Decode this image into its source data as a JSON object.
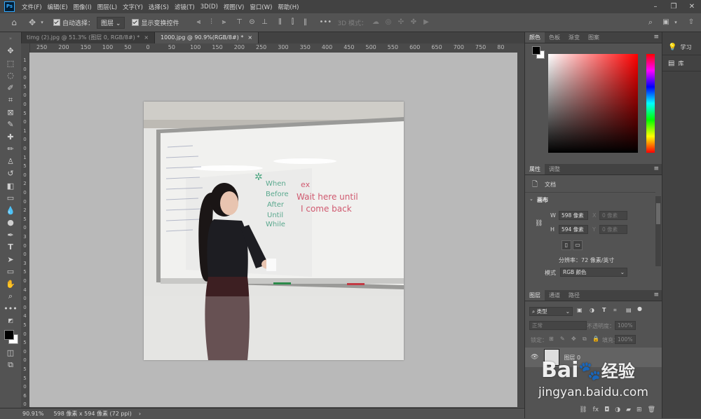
{
  "menu": {
    "items": [
      "文件(F)",
      "编辑(E)",
      "图像(I)",
      "图层(L)",
      "文字(Y)",
      "选择(S)",
      "滤镜(T)",
      "3D(D)",
      "视图(V)",
      "窗口(W)",
      "帮助(H)"
    ]
  },
  "options": {
    "auto_select_label": "自动选择：",
    "auto_select_value": "图层",
    "show_transform_label": "显示变换控件",
    "mode_3d_label": "3D 模式："
  },
  "tabs": [
    {
      "label": "timg (2).jpg @ 51.3% (图层 0, RGB/8#) *"
    },
    {
      "label": "1000.jpg @ 90.9%(RGB/8#) *"
    }
  ],
  "ruler": {
    "h_labels": [
      "250",
      "200",
      "150",
      "100",
      "50",
      "0",
      "50",
      "100",
      "150",
      "200",
      "250",
      "300",
      "350",
      "400",
      "450",
      "500",
      "550",
      "600",
      "650",
      "700",
      "750",
      "80"
    ],
    "v_labels": [
      "1",
      "0",
      "0",
      "5",
      "0",
      "0",
      "5",
      "0",
      "1",
      "0",
      "0",
      "1",
      "5",
      "0",
      "2",
      "0",
      "0",
      "2",
      "5",
      "0",
      "3",
      "0",
      "0",
      "3",
      "5",
      "0",
      "4",
      "0",
      "0",
      "4",
      "5",
      "0",
      "5",
      "0",
      "0",
      "5",
      "5",
      "0",
      "6",
      "0"
    ]
  },
  "whiteboard": {
    "green_words": [
      "When",
      "Before",
      "After",
      "Until",
      "While"
    ],
    "red_words": [
      "ex",
      "Wait here until",
      "I come back"
    ]
  },
  "status": {
    "zoom": "90.91%",
    "doc_info": "598 像素 x 594 像素 (72 ppi)"
  },
  "color_panel": {
    "tabs": [
      "颜色",
      "色板",
      "渐变",
      "图案"
    ]
  },
  "properties_panel": {
    "tabs": [
      "属性",
      "调整"
    ],
    "doc_label": "文档",
    "section": "画布",
    "w_label": "W",
    "w_value": "598 像素",
    "h_label": "H",
    "h_value": "594 像素",
    "x_label": "X",
    "x_value": "0 像素",
    "y_label": "Y",
    "y_value": "0 像素",
    "resolution": "分辨率：72 像素/英寸",
    "mode_label": "模式",
    "mode_value": "RGB 颜色"
  },
  "layers_panel": {
    "tabs": [
      "图层",
      "通道",
      "路径"
    ],
    "filter_value": "类型",
    "blend_mode": "正常",
    "opacity_label": "不透明度：",
    "opacity_value": "100%",
    "lock_label": "锁定：",
    "fill_label": "填充：",
    "fill_value": "100%",
    "layer_name": "图层 0"
  },
  "side": {
    "learn": "学习",
    "library": "库"
  },
  "watermark": {
    "brand_a": "Bai",
    "brand_b": "经验",
    "url": "jingyan.baidu.com"
  },
  "colors": {
    "accent": "#31a8ff",
    "canvas_bg": "#b9b9b9",
    "panel_bg": "#535353"
  }
}
